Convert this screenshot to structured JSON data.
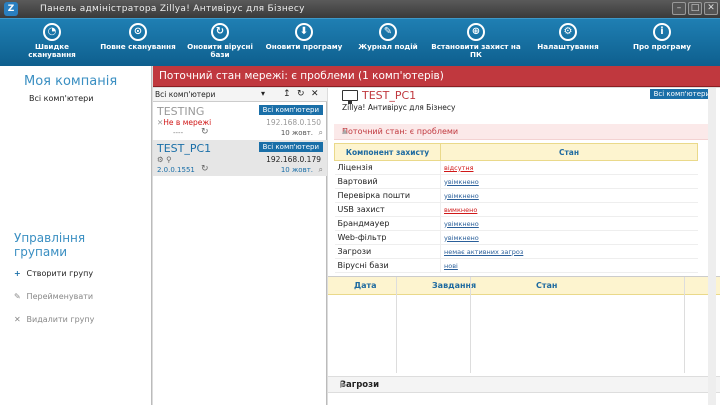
{
  "window": {
    "title": "Панель адміністратора Zillya! Антивірус для Бізнесу",
    "logo": "Z"
  },
  "toolbar": [
    {
      "label": "Швидке сканування",
      "icon": "quick-scan-icon",
      "glyph": "◔"
    },
    {
      "label": "Повне сканування",
      "icon": "full-scan-icon",
      "glyph": "⊙"
    },
    {
      "label": "Оновити вірусні бази",
      "icon": "update-db-icon",
      "glyph": "↻"
    },
    {
      "label": "Оновити програму",
      "icon": "update-app-icon",
      "glyph": "⬇"
    },
    {
      "label": "Журнал подій",
      "icon": "journal-icon",
      "glyph": "✎"
    },
    {
      "label": "Встановити захист на ПК",
      "icon": "install-icon",
      "glyph": "⊕"
    },
    {
      "label": "Налаштування",
      "icon": "settings-icon",
      "glyph": "⚙"
    },
    {
      "label": "Про програму",
      "icon": "info-icon",
      "glyph": "i"
    }
  ],
  "sidebar": {
    "company_title": "Моя компанія",
    "all_computers": "Всі комп'ютери",
    "group_title": "Управління групами",
    "actions": [
      {
        "icon": "plus-icon",
        "glyph": "+",
        "label": "Створити групу",
        "enabled": true
      },
      {
        "icon": "rename-icon",
        "glyph": "✎",
        "label": "Перейменувати",
        "enabled": false
      },
      {
        "icon": "delete-icon",
        "glyph": "✕",
        "label": "Видалити групу",
        "enabled": false
      }
    ]
  },
  "banner": {
    "text": "Поточний стан мережі: є проблеми (1 комп'ютерів)",
    "color": "#c0383e"
  },
  "computer_list": {
    "filter": "Всі комп'ютери",
    "computers": [
      {
        "name": "TESTING",
        "group": "Всі комп'ютери",
        "status": "Не в мережі",
        "ip": "192.168.0.150",
        "version": "----",
        "date": "10 жовт."
      },
      {
        "name": "TEST_PC1",
        "group": "Всі комп'ютери",
        "status": "",
        "ip": "192.168.0.179",
        "version": "2.0.0.1551",
        "date": "10 жовт."
      }
    ]
  },
  "detail": {
    "pc_name": "TEST_PC1",
    "product": "Zillya! Антивірус для Бізнесу",
    "group": "Всі комп'ютери",
    "status_text": "Поточний стан: є проблеми",
    "columns": {
      "component": "Компонент захисту",
      "state": "Стан"
    },
    "components": [
      {
        "name": "Ліцензія",
        "state": "відсутня",
        "bad": true
      },
      {
        "name": "Вартовий",
        "state": "увімкнено",
        "bad": false
      },
      {
        "name": "Перевірка пошти",
        "state": "увімкнено",
        "bad": false
      },
      {
        "name": "USB захист",
        "state": "вимкнено",
        "bad": true
      },
      {
        "name": "Брандмауер",
        "state": "увімкнено",
        "bad": false
      },
      {
        "name": "Web-фільтр",
        "state": "увімкнено",
        "bad": false
      },
      {
        "name": "Загрози",
        "state": "немає активних загроз",
        "bad": false
      },
      {
        "name": "Вірусні бази",
        "state": "нові",
        "bad": false
      }
    ],
    "history_columns": {
      "date": "Дата",
      "task": "Завдання",
      "state": "Стан"
    },
    "threats_section": "Загрози"
  }
}
